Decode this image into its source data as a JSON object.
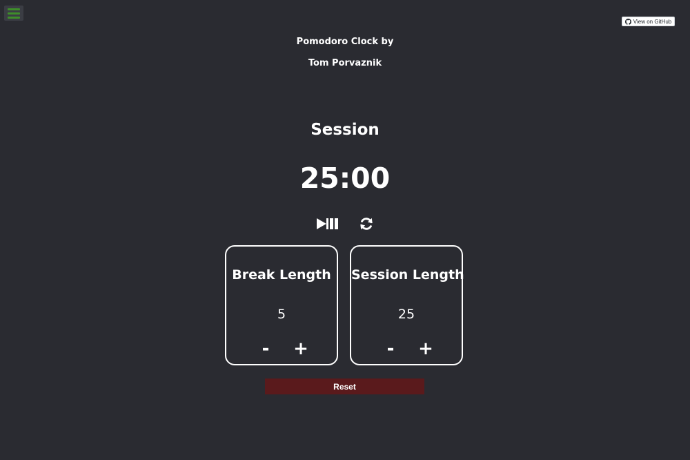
{
  "menu": {
    "icon": "hamburger-menu-icon",
    "color": "#3e8e2a"
  },
  "github": {
    "label": "View on GitHub",
    "icon": "github-icon"
  },
  "credit": {
    "line1": "Pomodoro Clock by",
    "line2": "Tom Porvaznik"
  },
  "timer": {
    "label": "Session",
    "display": "25:00"
  },
  "controls": {
    "play_pause_icon": "play-pause-icon",
    "refresh_icon": "refresh-icon"
  },
  "break": {
    "title": "Break Length",
    "value": "5",
    "decrement": "-",
    "increment": "+"
  },
  "session": {
    "title": "Session Length",
    "value": "25",
    "decrement": "-",
    "increment": "+"
  },
  "reset": {
    "label": "Reset",
    "color": "#5a1a1c"
  },
  "theme": {
    "background": "#2a2b31",
    "text": "#ffffff"
  }
}
